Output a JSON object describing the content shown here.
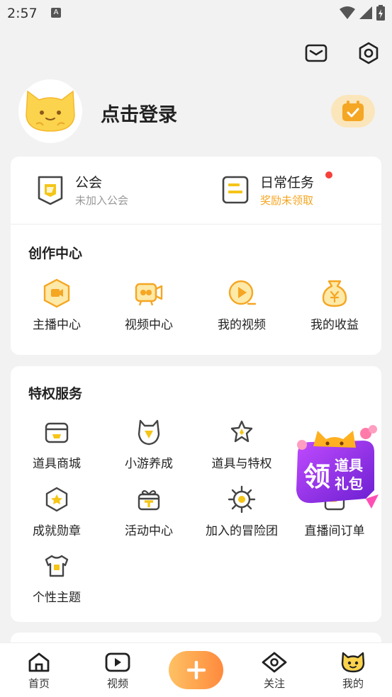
{
  "status": {
    "time": "2:57",
    "notif_letter": "A"
  },
  "header": {
    "login_text": "点击登录"
  },
  "quick": {
    "guild": {
      "title": "公会",
      "subtitle": "未加入公会"
    },
    "daily": {
      "title": "日常任务",
      "subtitle": "奖励未领取"
    }
  },
  "creation": {
    "title": "创作中心",
    "items": [
      {
        "label": "主播中心",
        "icon": "anchor-center-icon"
      },
      {
        "label": "视频中心",
        "icon": "video-camera-icon"
      },
      {
        "label": "我的视频",
        "icon": "play-circle-icon"
      },
      {
        "label": "我的收益",
        "icon": "yen-bag-icon"
      }
    ]
  },
  "privilege": {
    "title": "特权服务",
    "items": [
      {
        "label": "道具商城",
        "icon": "shop-icon"
      },
      {
        "label": "小游养成",
        "icon": "cat-shield-icon"
      },
      {
        "label": "道具与特权",
        "icon": "star-icon"
      },
      {
        "label": "直播间订单",
        "icon": "order-icon"
      },
      {
        "label": "成就勋章",
        "icon": "medal-icon"
      },
      {
        "label": "活动中心",
        "icon": "gift-icon"
      },
      {
        "label": "加入的冒险团",
        "icon": "gear-target-icon"
      },
      {
        "label": "个性主题",
        "icon": "tshirt-icon"
      }
    ]
  },
  "promo": {
    "line1": "领",
    "line2": "道具",
    "line3": "礼包"
  },
  "tabbar": {
    "items": [
      {
        "label": "首页",
        "icon": "home-icon"
      },
      {
        "label": "视频",
        "icon": "video-icon"
      },
      {
        "label": "关注",
        "icon": "follow-icon"
      },
      {
        "label": "我的",
        "icon": "profile-cat-icon"
      }
    ]
  },
  "colors": {
    "accent": "#f5a623",
    "promo_purple": "#7b2ff7"
  }
}
